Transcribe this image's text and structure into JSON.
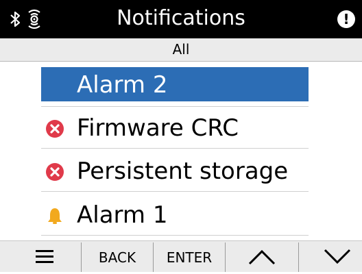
{
  "header": {
    "title": "Notifications",
    "bluetooth_icon": "bluetooth-icon",
    "signal_icon": "wireless-signal-icon",
    "alert_glyph": "!"
  },
  "filter": {
    "label": "All"
  },
  "notifications": [
    {
      "label": "Alarm 2",
      "icon": "none",
      "selected": true
    },
    {
      "label": "Firmware CRC",
      "icon": "error-icon",
      "selected": false
    },
    {
      "label": "Persistent storage",
      "icon": "error-icon",
      "selected": false
    },
    {
      "label": "Alarm 1",
      "icon": "bell-icon",
      "selected": false
    }
  ],
  "footer": {
    "menu_icon": "menu-icon",
    "back_label": "BACK",
    "enter_label": "ENTER",
    "up_icon": "chevron-up-icon",
    "down_icon": "chevron-down-icon"
  },
  "colors": {
    "header_bg": "#000000",
    "selected_bg": "#2c6db5",
    "error": "#e03a4a",
    "warning": "#f2a91e",
    "bar_bg": "#ebebeb"
  }
}
